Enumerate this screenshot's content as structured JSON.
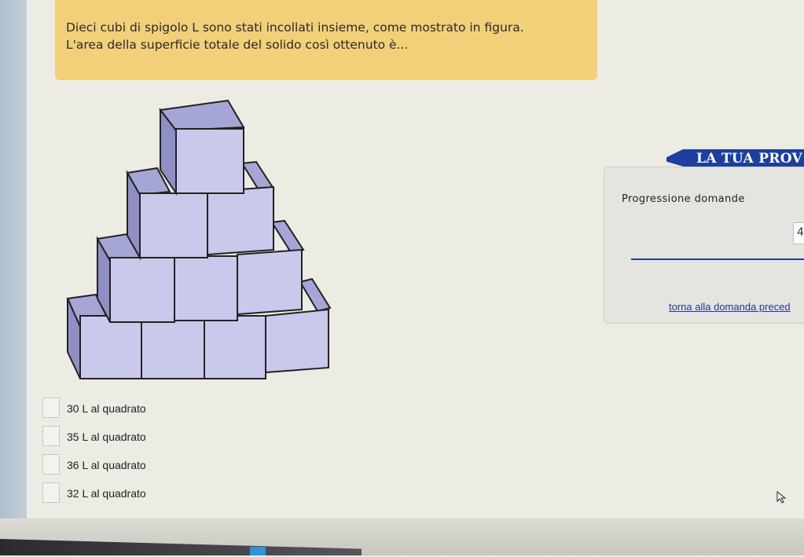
{
  "question": {
    "line1": "Dieci cubi di spigolo L sono stati incollati insieme, come mostrato in figura.",
    "line2": "L'area della superficie totale del solido così ottenuto è..."
  },
  "options": [
    {
      "label": "30 L al quadrato"
    },
    {
      "label": "35 L al quadrato"
    },
    {
      "label": "36 L al quadrato"
    },
    {
      "label": "32 L al quadrato"
    }
  ],
  "side_panel": {
    "header": "LA TUA PROV",
    "progress_title": "Progressione domande",
    "question_number": "4",
    "back_link": "torna alla domanda preced"
  },
  "figure": {
    "rows": [
      1,
      2,
      3,
      4
    ]
  },
  "colors": {
    "question_bg": "#f2cf79",
    "cube_front": "#c9c9ec",
    "cube_top": "#a5a5d6",
    "cube_side": "#8f8fc6",
    "panel_accent": "#1e3f9e"
  }
}
